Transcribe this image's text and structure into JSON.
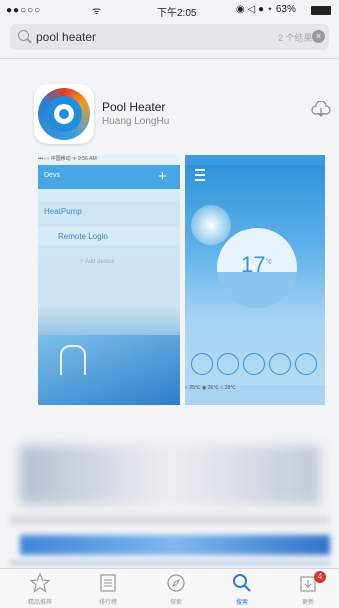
{
  "status_bar": {
    "signal": "●●○○○",
    "wifi": "ᯤ",
    "time": "下午2:05",
    "right": "◉ ◁ ● ⋆ 63%"
  },
  "search": {
    "query": "pool heater",
    "count": "2 个结果",
    "clear": "×",
    "icon": "search-icon"
  },
  "app": {
    "name": "Pool Heater",
    "developer": "Huang LongHu",
    "download_icon": "cloud-download-icon"
  },
  "screenshot1": {
    "status": "•••○○ 中国移动 ᯤ  9:56 AM",
    "nav_title": "Devs",
    "nav_add": "+",
    "row1": "HeatPump",
    "row2": "Remote Login",
    "row3": "+  Add device"
  },
  "screenshot2": {
    "temperature": "17",
    "temp_unit": "°c",
    "stats": "○ 25℃  ◉ 26℃  ○ 28℃"
  },
  "tabs": [
    {
      "label": "精品推荐",
      "icon": "star-icon"
    },
    {
      "label": "排行榜",
      "icon": "list-icon"
    },
    {
      "label": "探索",
      "icon": "compass-icon"
    },
    {
      "label": "搜索",
      "icon": "search-icon"
    },
    {
      "label": "更新",
      "icon": "update-icon",
      "badge": "4"
    }
  ]
}
